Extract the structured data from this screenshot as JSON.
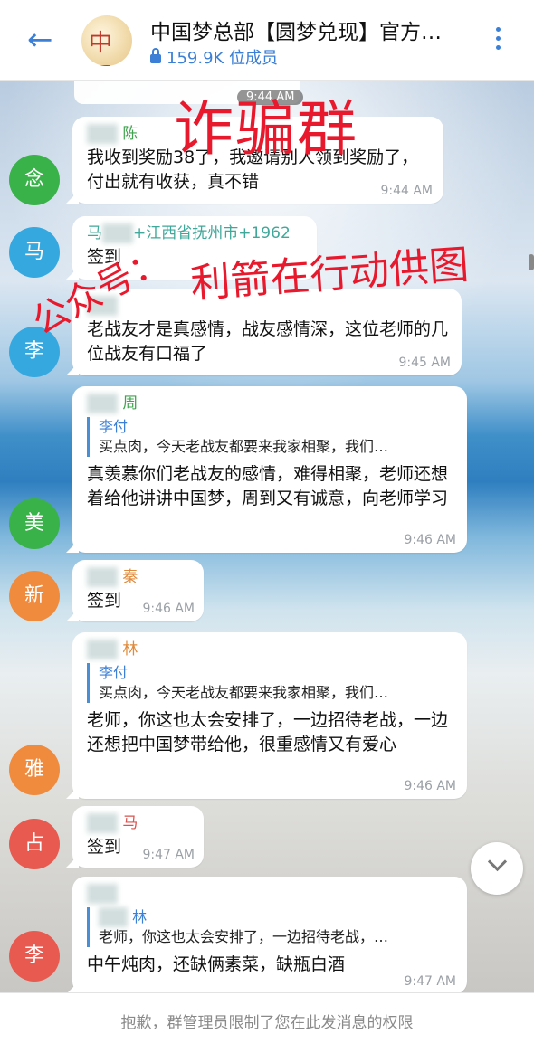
{
  "header": {
    "back_icon": "←",
    "title": "中国梦总部【圆梦兑现】官方…",
    "member_count": "159.9K 位成员",
    "logo_glyph": "中國夢"
  },
  "pinned": {
    "time": "9:44 AM"
  },
  "watermarks": {
    "scam": "诈骗群",
    "public_account": "公众号：",
    "public_account_name": "利箭在行动供图"
  },
  "messages": [
    {
      "avatar": "念",
      "avatar_color": "#3ab24a",
      "name_hidden": "老乔",
      "name": "陈",
      "name_color": "#3fa34d",
      "text": "我收到奖励38了，我邀请别人领到奖励了，付出就有收获，真不错",
      "time": "9:44 AM"
    },
    {
      "avatar": "马",
      "avatar_color": "#36a8e0",
      "name_hidden": "马某",
      "name": "江西省抚州市+1962",
      "name_prefix": "马",
      "name_color": "#3fa89a",
      "text": "签到",
      "time": ""
    },
    {
      "avatar": "李",
      "avatar_color": "#36a8e0",
      "name_hidden": "李某",
      "name": "",
      "name_color": "#2f8fd0",
      "text": "老战友才是真感情，战友感情深，这位老师的几位战友有口福了",
      "time": "9:45 AM"
    },
    {
      "avatar": "美",
      "avatar_color": "#3ab24a",
      "name_hidden": "锦华",
      "name": "周",
      "name_color": "#3fa34d",
      "quote_name": "李付",
      "quote_text": "买点肉，今天老战友都要来我家相聚，我们…",
      "text": "真羡慕你们老战友的感情，难得相聚，老师还想着给他讲讲中国梦，周到又有诚意，向老师学习",
      "time": "9:46 AM"
    },
    {
      "avatar": "新",
      "avatar_color": "#f08a3c",
      "name_hidden": "新民",
      "name": "秦",
      "name_color": "#e08a3a",
      "text": "签到",
      "time": "9:46 AM"
    },
    {
      "avatar": "雅",
      "avatar_color": "#f08a3c",
      "name_hidden": "雅某",
      "name": "林",
      "name_color": "#e08a3a",
      "quote_name": "李付",
      "quote_text": "买点肉，今天老战友都要来我家相聚，我们…",
      "text": "老师，你这也太会安排了，一边招待老战，一边还想把中国梦带给他，很重感情又有爱心",
      "time": "9:46 AM"
    },
    {
      "avatar": "占",
      "avatar_color": "#e85a4f",
      "name_hidden": "占英",
      "name": "马",
      "name_color": "#d9534f",
      "text": "签到",
      "time": "9:47 AM"
    },
    {
      "avatar": "李",
      "avatar_color": "#e85a4f",
      "name_hidden": "李付",
      "name": "",
      "name_color": "#d9534f",
      "quote_name": "林",
      "quote_name_hidden": "雅齐",
      "quote_text": "老师，你这也太会安排了，一边招待老战，…",
      "text": "中午炖肉，还缺俩素菜，缺瓶白酒",
      "time": "9:47 AM"
    }
  ],
  "footer": {
    "notice": "抱歉，群管理员限制了您在此发消息的权限"
  }
}
